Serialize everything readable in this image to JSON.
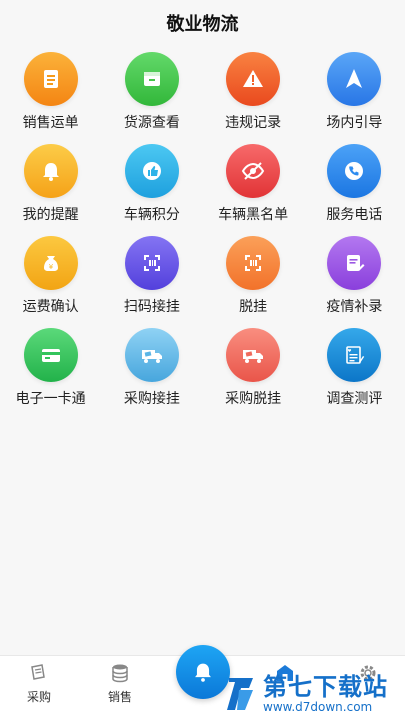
{
  "header": {
    "title": "敬业物流"
  },
  "grid": [
    {
      "label": "销售运单",
      "icon": "document-icon",
      "color": "#f59a1a"
    },
    {
      "label": "货源查看",
      "icon": "cargo-icon",
      "color": "#46c64a"
    },
    {
      "label": "违规记录",
      "icon": "warning-icon",
      "color": "#f2632b"
    },
    {
      "label": "场内引导",
      "icon": "navigation-icon",
      "color": "#3c8ef2"
    },
    {
      "label": "我的提醒",
      "icon": "bell-icon",
      "color": "#f7b52a"
    },
    {
      "label": "车辆积分",
      "icon": "thumb-up-icon",
      "color": "#2eb3e8"
    },
    {
      "label": "车辆黑名单",
      "icon": "hidden-eye-icon",
      "color": "#ef4a4f"
    },
    {
      "label": "服务电话",
      "icon": "phone-icon",
      "color": "#2e8cef"
    },
    {
      "label": "运费确认",
      "icon": "money-bag-icon",
      "color": "#f6b623"
    },
    {
      "label": "扫码接挂",
      "icon": "scan-icon",
      "color": "#6a5ce8"
    },
    {
      "label": "脱挂",
      "icon": "unhook-icon",
      "color": "#f58a3a"
    },
    {
      "label": "疫情补录",
      "icon": "edit-form-icon",
      "color": "#9b57e3"
    },
    {
      "label": "电子一卡通",
      "icon": "card-icon",
      "color": "#33c45c"
    },
    {
      "label": "采购接挂",
      "icon": "truck-icon",
      "color": "#5ab5e6"
    },
    {
      "label": "采购脱挂",
      "icon": "truck-icon",
      "color": "#ef6a5c"
    },
    {
      "label": "调查测评",
      "icon": "survey-icon",
      "color": "#1a8fd8"
    }
  ],
  "bottom_nav": {
    "tabs": [
      {
        "label": "采购",
        "icon": "purchase-icon"
      },
      {
        "label": "销售",
        "icon": "database-icon"
      },
      {
        "label": "",
        "icon": "home-icon"
      },
      {
        "label": "",
        "icon": "settings-icon"
      }
    ],
    "center": {
      "icon": "bell-icon",
      "color": "#1190e6"
    }
  },
  "watermark": {
    "main": "第七下载站",
    "url": "www.d7down.com"
  }
}
